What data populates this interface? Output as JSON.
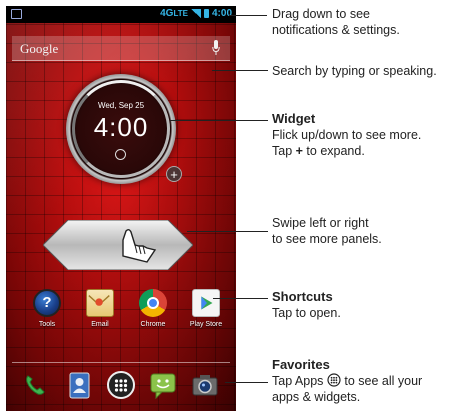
{
  "statusbar": {
    "network": "4G",
    "network_sub": "LTE",
    "time": "4:00"
  },
  "search": {
    "brand": "Google"
  },
  "widget": {
    "date": "Wed, Sep 25",
    "time": "4:00",
    "expand_symbol": "+"
  },
  "shortcuts": [
    {
      "label": "Tools",
      "icon": "tools-icon"
    },
    {
      "label": "Email",
      "icon": "email-icon"
    },
    {
      "label": "Chrome",
      "icon": "chrome-icon"
    },
    {
      "label": "Play Store",
      "icon": "play-store-icon"
    }
  ],
  "dock": [
    {
      "icon": "phone-icon"
    },
    {
      "icon": "contacts-icon"
    },
    {
      "icon": "apps-icon"
    },
    {
      "icon": "messaging-icon"
    },
    {
      "icon": "camera-icon"
    }
  ],
  "callouts": {
    "notifications": {
      "line1": "Drag down to see",
      "line2": "notifications & settings."
    },
    "search": {
      "line1": "Search by typing or speaking."
    },
    "widget": {
      "title": "Widget",
      "line1": "Flick up/down to see more.",
      "line2_pre": "Tap ",
      "line2_bold": "+",
      "line2_post": " to expand."
    },
    "swipe": {
      "line1": "Swipe left or right",
      "line2": "to see more panels."
    },
    "shortcuts": {
      "title": "Shortcuts",
      "line1": "Tap to open."
    },
    "favorites": {
      "title": "Favorites",
      "line1_pre": "Tap Apps ",
      "line1_post": " to see all your",
      "line2": "apps & widgets."
    }
  },
  "colors": {
    "wallpaper": "#c01010",
    "status_accent": "#35b5e5"
  }
}
